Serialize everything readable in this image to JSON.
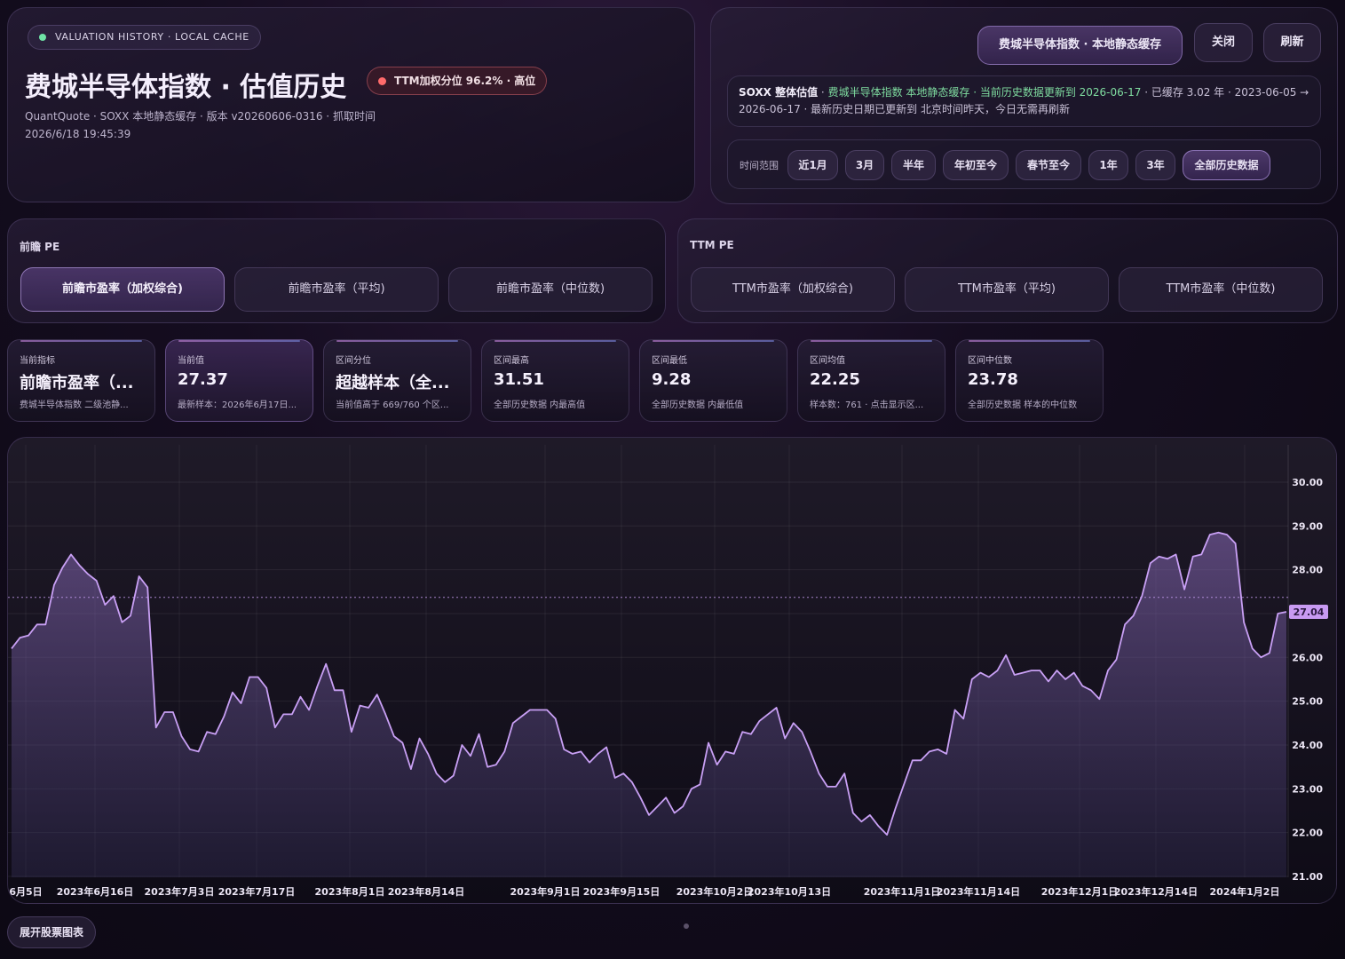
{
  "header": {
    "tag": "VALUATION HISTORY · LOCAL CACHE",
    "title": "费城半导体指数 · 估值历史",
    "risk_badge": "TTM加权分位 96.2% · 高位",
    "meta_line1": "QuantQuote · SOXX 本地静态缓存 · 版本 v20260606-0316 · 抓取时间",
    "meta_line2": "2026/6/18 19:45:39"
  },
  "actions": {
    "source": "费城半导体指数 · 本地静态缓存",
    "close": "关闭",
    "refresh": "刷新"
  },
  "status": {
    "label": "SOXX 整体估值",
    "source_text": "费城半导体指数 本地静态缓存 · 当前历史数据更新到 2026-06-17",
    "detail": " · 已缓存 3.02 年 · 2023-06-05 → 2026-06-17 · 最新历史日期已更新到 北京时间昨天，今日无需再刷新"
  },
  "range": {
    "label": "时间范围",
    "options": [
      "近1月",
      "3月",
      "半年",
      "年初至今",
      "春节至今",
      "1年",
      "3年",
      "全部历史数据"
    ],
    "active": "全部历史数据"
  },
  "pe_groups": [
    {
      "title": "前瞻 PE",
      "options": [
        "前瞻市盈率（加权综合)",
        "前瞻市盈率（平均)",
        "前瞻市盈率（中位数)"
      ],
      "active_index": 0
    },
    {
      "title": "TTM PE",
      "options": [
        "TTM市盈率（加权综合)",
        "TTM市盈率（平均)",
        "TTM市盈率（中位数)"
      ],
      "active_index": -1
    }
  ],
  "stats": [
    {
      "label": "当前指标",
      "value": "前瞻市盈率（...",
      "sub": "费城半导体指数 二级池静..."
    },
    {
      "label": "当前值",
      "value": "27.37",
      "sub": "最新样本：2026年6月17日..."
    },
    {
      "label": "区间分位",
      "value": "超越样本（全...",
      "sub": "当前值高于 669/760 个区..."
    },
    {
      "label": "区间最高",
      "value": "31.51",
      "sub": "全部历史数据 内最高值"
    },
    {
      "label": "区间最低",
      "value": "9.28",
      "sub": "全部历史数据 内最低值"
    },
    {
      "label": "区间均值",
      "value": "22.25",
      "sub": "样本数：761 · 点击显示区..."
    },
    {
      "label": "区间中位数",
      "value": "23.78",
      "sub": "全部历史数据 样本的中位数"
    }
  ],
  "chart_data": {
    "type": "area",
    "x_tick_labels": [
      "6月5日",
      "2023年6月16日",
      "2023年7月3日",
      "2023年7月17日",
      "2023年8月1日",
      "2023年8月14日",
      "2023年9月1日",
      "2023年9月15日",
      "2023年10月2日",
      "2023年10月13日",
      "2023年11月1日",
      "2023年11月14日",
      "2023年12月1日",
      "2023年12月14日",
      "2024年1月2日"
    ],
    "y_ticks": [
      21,
      22,
      23,
      24,
      25,
      26,
      27,
      28,
      29,
      30
    ],
    "ylim": [
      20.98,
      30.85
    ],
    "reference_value": 27.37,
    "last_value_label": "27.04",
    "line_color": "#c9a0f5",
    "values": [
      26.2,
      26.45,
      26.5,
      26.75,
      26.75,
      27.65,
      28.05,
      28.35,
      28.1,
      27.9,
      27.75,
      27.2,
      27.4,
      26.8,
      26.95,
      27.85,
      27.6,
      24.4,
      24.75,
      24.75,
      24.2,
      23.9,
      23.85,
      24.3,
      24.25,
      24.65,
      25.2,
      24.95,
      25.55,
      25.55,
      25.3,
      24.4,
      24.7,
      24.7,
      25.1,
      24.8,
      25.35,
      25.85,
      25.25,
      25.25,
      24.3,
      24.9,
      24.85,
      25.15,
      24.7,
      24.2,
      24.05,
      23.45,
      24.15,
      23.8,
      23.35,
      23.15,
      23.3,
      24.0,
      23.75,
      24.25,
      23.5,
      23.55,
      23.85,
      24.5,
      24.65,
      24.8,
      24.8,
      24.8,
      24.6,
      23.9,
      23.8,
      23.85,
      23.6,
      23.8,
      23.95,
      23.25,
      23.35,
      23.15,
      22.8,
      22.4,
      22.6,
      22.8,
      22.45,
      22.6,
      23.0,
      23.1,
      24.05,
      23.55,
      23.85,
      23.8,
      24.3,
      24.25,
      24.55,
      24.7,
      24.85,
      24.15,
      24.5,
      24.3,
      23.85,
      23.35,
      23.05,
      23.05,
      23.35,
      22.45,
      22.25,
      22.4,
      22.15,
      21.95,
      22.55,
      23.1,
      23.65,
      23.65,
      23.85,
      23.9,
      23.8,
      24.8,
      24.6,
      25.5,
      25.65,
      25.55,
      25.7,
      26.05,
      25.6,
      25.65,
      25.7,
      25.7,
      25.45,
      25.7,
      25.5,
      25.65,
      25.35,
      25.25,
      25.05,
      25.7,
      25.95,
      26.75,
      26.95,
      27.4,
      28.15,
      28.3,
      28.25,
      28.35,
      27.55,
      28.3,
      28.35,
      28.8,
      28.85,
      28.8,
      28.6,
      26.8,
      26.2,
      26.0,
      26.1,
      27.0,
      27.04
    ]
  },
  "footer": {
    "expand": "展开股票图表"
  }
}
